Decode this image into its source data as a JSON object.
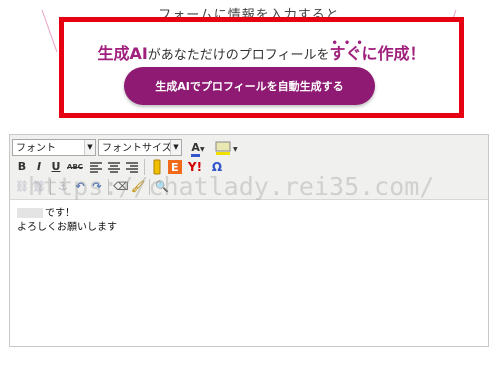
{
  "intro": {
    "text": "フォームに情報を入力すると"
  },
  "promo": {
    "headline_part1": "生成AI",
    "headline_part2": "があなただけのプロフィールを",
    "headline_part3": "すぐに作成！",
    "button_label": "生成AIでプロフィールを自動生成する",
    "accent_color": "#a0207d",
    "border_color": "#e60012"
  },
  "editor": {
    "font_select": "フォント",
    "size_select": "フォントサイズ",
    "font_color_label": "A",
    "bold": "B",
    "italic": "I",
    "underline": "U",
    "strike": "ABC",
    "youtube_label": "Y!",
    "omega": "Ω",
    "line1": "です！",
    "line2": "よろしくお願いします"
  },
  "watermark": "https://chatlady.rei35.com/"
}
